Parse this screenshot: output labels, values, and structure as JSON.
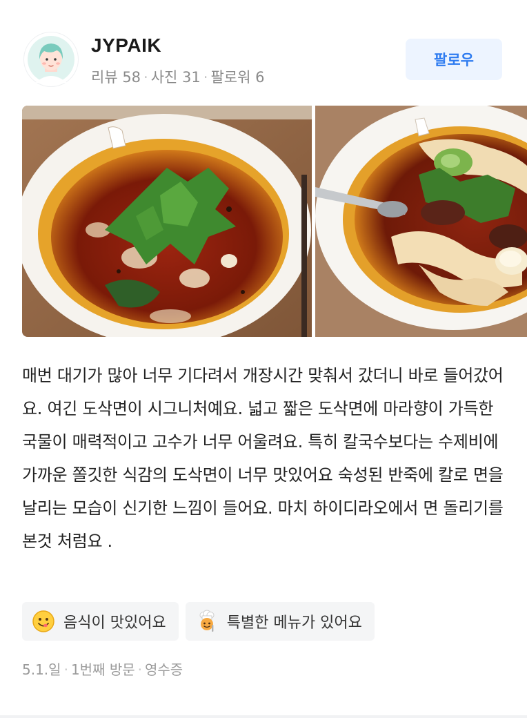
{
  "user": {
    "name": "JYPAIK",
    "stats": {
      "reviews": "리뷰 58",
      "photos": "사진 31",
      "followers": "팔로워 6"
    },
    "follow_label": "팔로우"
  },
  "photos": [
    {
      "icon": "spicy-noodle-soup-with-cilantro"
    },
    {
      "icon": "knife-cut-noodle-soup-with-beef"
    }
  ],
  "review_text": "매번 대기가 많아 너무 기다려서 개장시간 맞춰서 갔더니 바로 들어갔어요. 여긴 도삭면이 시그니처예요. 넓고 짧은 도삭면에 마라향이 가득한 국물이 매력적이고 고수가 너무 어울려요. 특히 칼국수보다는 수제비에 가까운 쫄깃한 식감의 도삭면이 너무 맛있어요 숙성된 반죽에 칼로 면을 날리는 모습이 신기한 느낌이 들어요. 마치 하이디라오에서 면 돌리기를 본것 처럼요 .",
  "tags": [
    {
      "label": "음식이 맛있어요",
      "icon": "yum-face-icon"
    },
    {
      "label": "특별한 메뉴가 있어요",
      "icon": "chef-icon"
    }
  ],
  "meta": {
    "date": "5.1.일",
    "visit": "1번째 방문",
    "verification": "영수증"
  },
  "colors": {
    "accent": "#2e7bf0",
    "follow_bg": "#edf4ff",
    "tag_bg": "#f4f5f6",
    "muted_text": "#8a8a8a"
  }
}
